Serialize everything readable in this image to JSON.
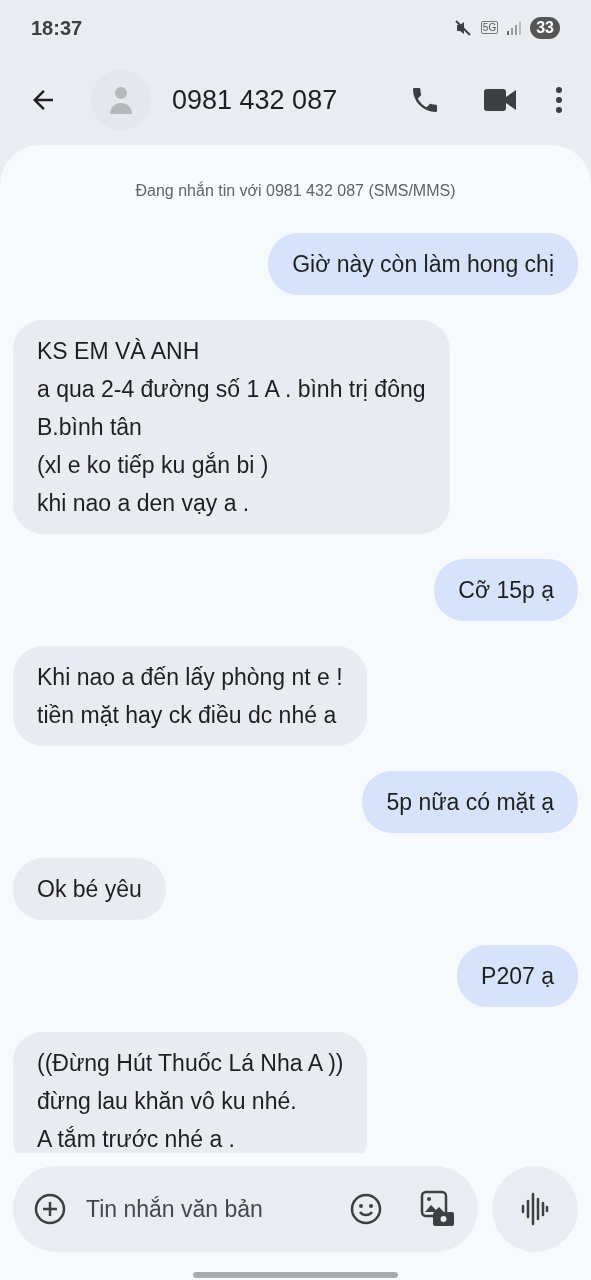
{
  "status_bar": {
    "time": "18:37",
    "network": "5G",
    "battery": "33",
    "muted": true
  },
  "header": {
    "contact": "0981 432 087"
  },
  "conversation": {
    "intro": "Đang nhắn tin với 0981 432 087 (SMS/MMS)",
    "messages": [
      {
        "kind": "sent",
        "text": "Giờ này còn làm hong chị"
      },
      {
        "kind": "received",
        "text": "KS EM VÀ ANH\na qua 2-4 đường số 1 A . bình trị đông\nB.bình tân\n(xl e ko tiếp ku gắn bi )\nkhi nao a den vạy a ."
      },
      {
        "kind": "sent",
        "text": "Cỡ 15p ạ"
      },
      {
        "kind": "received",
        "text": "Khi nao a đến lấy phòng nt e !\ntiền mặt hay ck điều dc nhé a"
      },
      {
        "kind": "sent",
        "text": "5p nữa có mặt ạ"
      },
      {
        "kind": "received",
        "text": "Ok bé yêu"
      },
      {
        "kind": "sent",
        "text": "P207 ạ"
      },
      {
        "kind": "received",
        "text": "((Đừng Hút Thuốc Lá Nha A ))\nđừng lau khăn vô ku nhé.\nA tắm trước nhé a ."
      }
    ]
  },
  "composer": {
    "placeholder": "Tin nhắn văn bản"
  }
}
